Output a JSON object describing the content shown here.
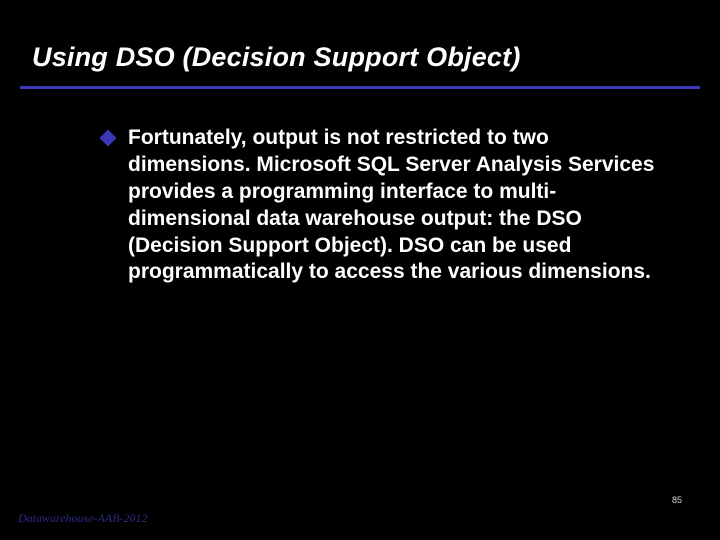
{
  "slide": {
    "title": "Using DSO (Decision Support  Object)",
    "bullets": [
      "Fortunately, output is not restricted to two dimensions. Microsoft SQL  Server Analysis Services provides a programming interface to multi-dimensional data warehouse output: the DSO (Decision Support  Object). DSO can be used programmatically to access the various dimensions."
    ],
    "page_number": "85",
    "footer": "Datawarehouse-AAB-2012"
  },
  "colors": {
    "accent": "#3a3ab8"
  }
}
